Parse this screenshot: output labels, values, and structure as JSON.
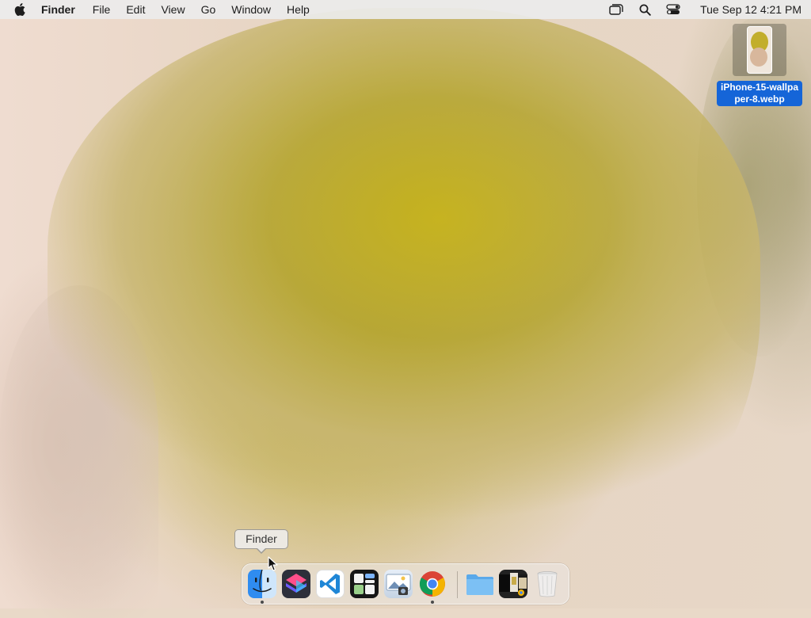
{
  "menubar": {
    "app_name": "Finder",
    "menus": [
      "File",
      "Edit",
      "View",
      "Go",
      "Window",
      "Help"
    ],
    "clock": "Tue Sep 12  4:21 PM"
  },
  "desktop": {
    "file_name": "iPhone-15-wallpaper-8.webp"
  },
  "tooltip": {
    "text": "Finder"
  },
  "dock": {
    "items": [
      {
        "name": "Finder",
        "icon": "finder-icon",
        "running": true
      },
      {
        "name": "Shortcuts",
        "icon": "shortcuts-icon",
        "running": false
      },
      {
        "name": "Visual Studio Code",
        "icon": "vscode-icon",
        "running": false
      },
      {
        "name": "Widgets",
        "icon": "widgets-icon",
        "running": false
      },
      {
        "name": "Preview",
        "icon": "preview-icon",
        "running": false
      },
      {
        "name": "Google Chrome",
        "icon": "chrome-icon",
        "running": true
      },
      {
        "name": "Folder",
        "icon": "folder-icon",
        "running": false
      },
      {
        "name": "Stack",
        "icon": "stack-icon",
        "running": false
      },
      {
        "name": "Trash",
        "icon": "trash-icon",
        "running": false
      }
    ]
  },
  "colors": {
    "selection_blue": "#1565d8",
    "wallpaper_yellow": "#c6b31f",
    "wallpaper_cream": "#e9d9c8"
  }
}
